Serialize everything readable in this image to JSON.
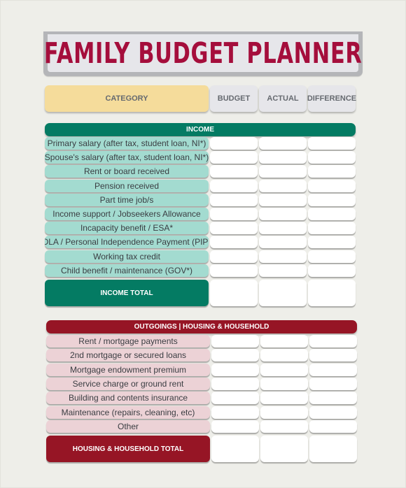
{
  "title": "FAMILY BUDGET PLANNER",
  "header": {
    "category": "CATEGORY",
    "columns": [
      "BUDGET",
      "ACTUAL",
      "DIFFERENCE"
    ]
  },
  "colors": {
    "title": "#a50e3c",
    "income": "#047b63",
    "income_row": "#a3dbd0",
    "outgoings": "#961525",
    "outgoings_row": "#ecd2d6",
    "category_header": "#f5dc9b"
  },
  "income": {
    "heading": "INCOME",
    "items": [
      "Primary salary (after tax, student loan, NI*)",
      "Spouse's salary (after tax, student loan, NI*)",
      "Rent or board received",
      "Pension received",
      "Part time job/s",
      "Income support / Jobseekers Allowance",
      "Incapacity benefit / ESA*",
      "DLA / Personal Independence Payment (PIP)",
      "Working tax credit",
      "Child benefit / maintenance (GOV*)"
    ],
    "total_label": "INCOME TOTAL"
  },
  "outgoings": {
    "heading": "OUTGOINGS | HOUSING & HOUSEHOLD",
    "items": [
      "Rent / mortgage payments",
      "2nd mortgage or secured loans",
      "Mortgage endowment premium",
      "Service charge or ground rent",
      "Building and contents insurance",
      "Maintenance (repairs, cleaning, etc)",
      "Other"
    ],
    "total_label": "HOUSING & HOUSEHOLD TOTAL"
  }
}
